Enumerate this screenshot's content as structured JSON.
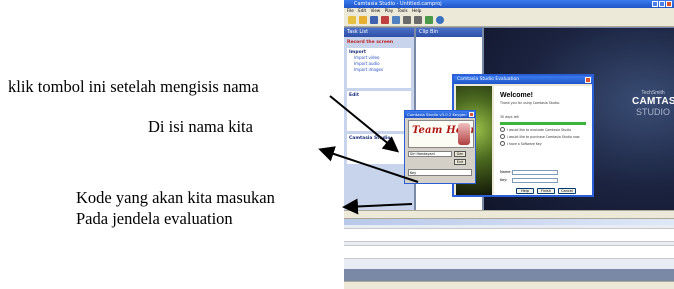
{
  "annotations": {
    "top": "klik tombol ini setelah mengisis nama",
    "middle": "Di isi nama kita",
    "bottom_line1": "Kode yang akan kita masukan",
    "bottom_line2": "Pada jendela evaluation"
  },
  "app": {
    "title": "Camtasia Studio - Untitled.camproj",
    "menu": [
      "File",
      "Edit",
      "View",
      "Play",
      "Tools",
      "Help"
    ],
    "left_panel": {
      "header": "Task List",
      "record": "Record the screen",
      "import_heading": "Import",
      "import_links": [
        "Import video",
        "Import audio",
        "Import images"
      ],
      "edit_heading": "Edit",
      "produce_heading": "Camtasia Studio"
    },
    "clip_bin": {
      "title": "Clip Bin"
    },
    "splash": {
      "brand_small": "TechSmith",
      "brand_main": "CAMTASIA",
      "brand_sub": "STUDIO"
    }
  },
  "eval_dialog": {
    "title": "Camtasia Studio Evaluation",
    "welcome": "Welcome!",
    "thank_you": "Thank you for using Camtasia Studio.",
    "days_label": "30 days left",
    "options": [
      "I would like to evaluate Camtasia Studio",
      "I would like to purchase Camtasia Studio now",
      "I have a Software Key"
    ],
    "name_label": "Name:",
    "key_label": "Key:",
    "buttons": [
      "Help",
      "Finish",
      "Cancel"
    ]
  },
  "keygen": {
    "title": "Camtasia Studio v3.0.2 Keygen",
    "logo_text": "Team Hellraiser",
    "name_value": "Siri Handayani",
    "gen_button": "Gen",
    "exit_button": "Exit",
    "key_label": "Key"
  }
}
